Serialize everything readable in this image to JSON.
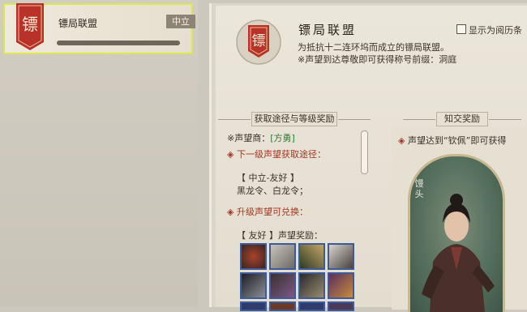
{
  "faction_list": {
    "card": {
      "emblem_char": "镖",
      "name": "镖局联盟",
      "tag": "中立",
      "progress": 0.0
    }
  },
  "detail": {
    "emblem_char": "镖",
    "title": "镖局联盟",
    "description_line1": "为抵抗十二连环坞而成立的镖局联盟。",
    "description_line2": "※声望到达尊敬即可获得称号前缀：洞庭",
    "show_journey_label": "显示为阅历条",
    "left_section": {
      "header": "获取途径与等级奖励",
      "merchant_prefix": "※声望商：",
      "merchant_name": "[方勇]",
      "next_level_label": "下一级声望获取途径：",
      "level_range": "【 中立-友好 】",
      "level_items": "黑龙令、白龙令；",
      "upgrade_label": "升级声望可兑换：",
      "reward_level": "【 友好 】声望奖励："
    },
    "right_section": {
      "header": "知交奖励",
      "reward_text": "声望达到“钦佩”即可获得",
      "portrait_name": "馒头"
    }
  },
  "colors": {
    "accent_red": "#a5361f",
    "merchant_green": "#2d7a2b",
    "selection": "#d9e84a"
  }
}
